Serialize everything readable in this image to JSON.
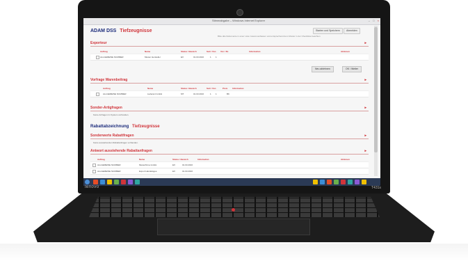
{
  "window": {
    "title": "Stimmabgabe – Windows Internet Explorer",
    "controls": [
      "–",
      "□",
      "×"
    ]
  },
  "app": {
    "brand": "ADAM DSS",
    "brand_accent": "Tiefzeugnisse",
    "top_buttons": [
      "Starten und Speichern",
      "Abmelden"
    ],
    "top_note": "Bitte alle Dokumente in einer Liste zusammenfassen und entsprechend dem Muster in der Checkliste beachten"
  },
  "section1": {
    "title": "Exporteur",
    "expand_icon": "▸",
    "columns": [
      "Auftrag",
      "Name",
      "Status / Bereich",
      "Seit / Von",
      "Vol. / Nr.",
      "Information",
      "Aktionen"
    ],
    "rows": [
      {
        "auftrag": "ALLGEMEINE NUMMER",
        "name": "Muster Hersteller",
        "status": "EX",
        "date": "01.03.2016",
        "vol": "1",
        "nr": "1"
      }
    ],
    "buttons": [
      "Neu ablehnen",
      "OK / Weiter"
    ]
  },
  "section2": {
    "title": "Vorfrage Warenbeitrag",
    "columns": [
      "Auftrag",
      "Name",
      "Status / Bereich",
      "Seit / Von",
      "Preis",
      "Information"
    ],
    "rows": [
      {
        "auftrag": "ALLGEMEINE NUMMER",
        "name": "Lieferant GmbH",
        "status": "MT",
        "date": "01.03.2016",
        "vol": "1",
        "nr": "1",
        "extra": "BK"
      }
    ]
  },
  "section3": {
    "title": "Sonder-Artigfragen",
    "note": "Keine Anfragen im System vorhanden."
  },
  "big_heading": {
    "main": "Rabattabzeichnung",
    "accent": "Tiefzeugnisse"
  },
  "section4": {
    "title": "Sonderwerte Rabattfragen",
    "note": "Keine ausstehenden Rabattanfragen vorhanden."
  },
  "section5": {
    "title": "Antwort ausstehende Rabattanfragen",
    "columns": [
      "Auftrag",
      "Name",
      "Status / Bereich",
      "Information",
      "Aktionen"
    ],
    "rows": [
      {
        "auftrag": "ALLGEMEINE NUMMER",
        "name": "Musterfirma GmbH",
        "status": "EX",
        "date": "01.03.2016"
      },
      {
        "auftrag": "ALLGEMEINE NUMMER",
        "name": "Export Handelsges.",
        "status": "EX",
        "date": "01.03.2016"
      }
    ]
  },
  "taskbar": {
    "icon_colors": [
      "#e44d26",
      "#3c8dd6",
      "#f0c000",
      "#6ab04c",
      "#d0343a",
      "#8a5ad4",
      "#2fa6a0"
    ],
    "tray_right": [
      "#f0c000",
      "#3c8dd6",
      "#e44d26",
      "#6ab04c",
      "#d0343a",
      "#2fa6a0",
      "#8a5ad4",
      "#f0c000"
    ]
  },
  "hardware": {
    "brand": "lenovo",
    "model": "T431s"
  }
}
